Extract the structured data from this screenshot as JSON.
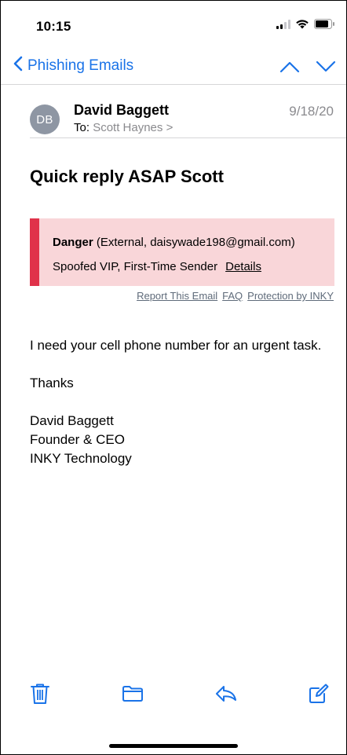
{
  "status_bar": {
    "time": "10:15"
  },
  "nav": {
    "back_label": "Phishing Emails"
  },
  "email": {
    "avatar_initials": "DB",
    "sender_name": "David Baggett",
    "date": "9/18/20",
    "to_label": "To:",
    "to_name": "Scott Haynes >",
    "subject": "Quick reply ASAP Scott"
  },
  "warning_banner": {
    "level": "Danger",
    "sender_info": " (External, daisywade198@gmail.com)",
    "reasons": "Spoofed VIP, First-Time Sender",
    "details_link": "Details",
    "links": [
      "Report This Email",
      "FAQ",
      "Protection by INKY"
    ],
    "colors": {
      "stripe": "#e0324a",
      "background": "#f9d6d9"
    }
  },
  "body": {
    "paragraph": "I need your cell phone number for an urgent task.",
    "closing": "Thanks",
    "signature": [
      "David Baggett",
      "Founder & CEO",
      "INKY Technology"
    ]
  },
  "toolbar": {
    "icons": [
      "trash-icon",
      "folder-icon",
      "reply-icon",
      "compose-icon"
    ]
  },
  "colors": {
    "accent": "#1a73e8"
  }
}
